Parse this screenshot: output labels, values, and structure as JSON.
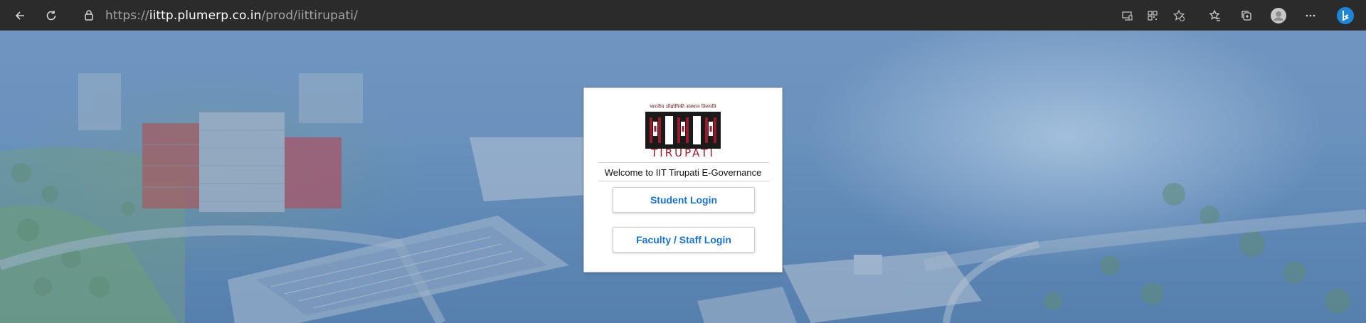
{
  "browser": {
    "url_prefix": "https://",
    "url_host": "iittp.plumerp.co.in",
    "url_path": "/prod/iittirupati/",
    "icons": [
      "back-icon",
      "refresh-icon",
      "lock-icon",
      "app-available-icon",
      "qr-code-icon",
      "favorite-add-icon",
      "favorites-icon",
      "collections-icon",
      "profile-avatar-icon",
      "more-icon",
      "bing-copilot-icon"
    ]
  },
  "card": {
    "logo_hindi": "भारतीय प्रौद्योगिकी संस्थान तिरुपति",
    "logo_wordmark": "TIRUPATI",
    "welcome": "Welcome to IIT Tirupati E-Governance",
    "student_login": "Student Login",
    "staff_login": "Faculty / Staff Login"
  },
  "colors": {
    "toolbar_bg": "#2b2b2b",
    "link_blue": "#1a73c8",
    "logo_red": "#9b1b2a"
  }
}
